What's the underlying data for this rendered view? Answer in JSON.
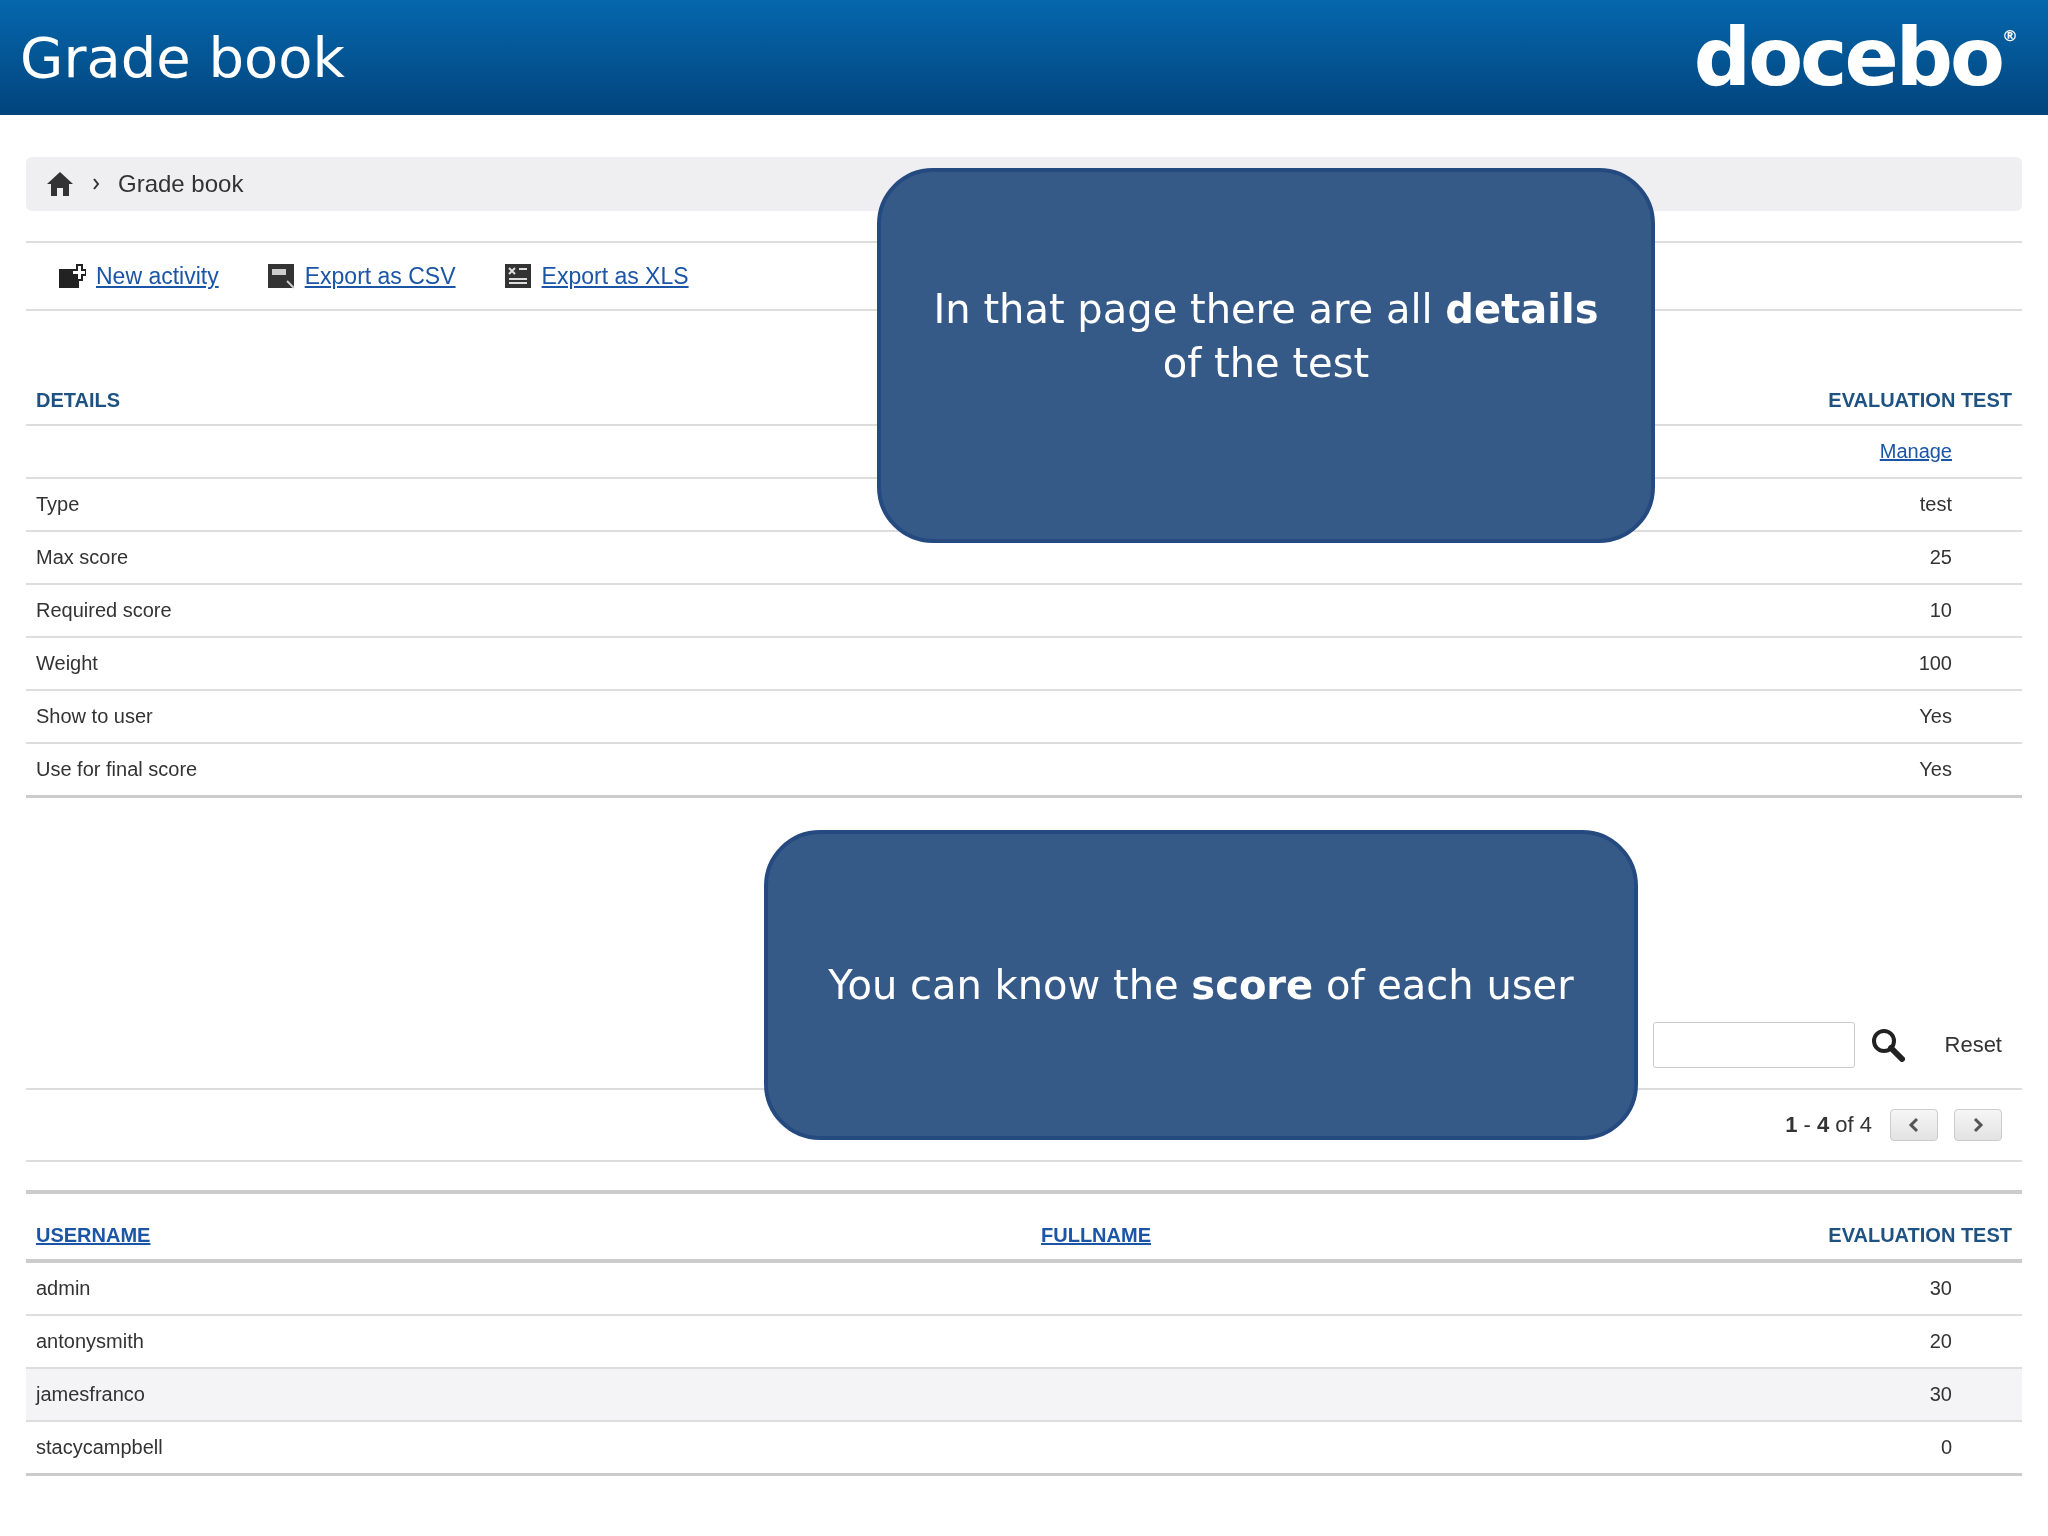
{
  "header": {
    "title": "Grade book",
    "logo": "docebo",
    "logo_mark": "®"
  },
  "breadcrumb": {
    "current": "Grade book"
  },
  "actions": [
    {
      "label": "New activity",
      "kind": "add"
    },
    {
      "label": "Export as CSV",
      "kind": "csv"
    },
    {
      "label": "Export as XLS",
      "kind": "xls"
    }
  ],
  "details_table": {
    "columns": [
      "DETAILS",
      "EVALUATION TEST"
    ],
    "manage_link": "Manage",
    "rows": [
      {
        "label": "Type",
        "value": "test"
      },
      {
        "label": "Max score",
        "value": "25"
      },
      {
        "label": "Required score",
        "value": "10"
      },
      {
        "label": "Weight",
        "value": "100"
      },
      {
        "label": "Show to user",
        "value": "Yes"
      },
      {
        "label": "Use for final score",
        "value": "Yes"
      }
    ]
  },
  "filter": {
    "reset": "Reset"
  },
  "pagination": {
    "label": "**1** - **4** of 4"
  },
  "users_table": {
    "columns": [
      "USERNAME",
      "FULLNAME",
      "EVALUATION TEST"
    ],
    "rows": [
      {
        "username": "admin",
        "score": "30",
        "highlighted": false
      },
      {
        "username": "antonysmith",
        "score": "20",
        "highlighted": false
      },
      {
        "username": "jamesfranco",
        "score": "30",
        "highlighted": true
      },
      {
        "username": "stacycampbell",
        "score": "0",
        "highlighted": false
      }
    ]
  },
  "callouts": [
    {
      "text": "In that page there are all **details** of the test"
    },
    {
      "text": "You can know the **score** of each user"
    }
  ]
}
